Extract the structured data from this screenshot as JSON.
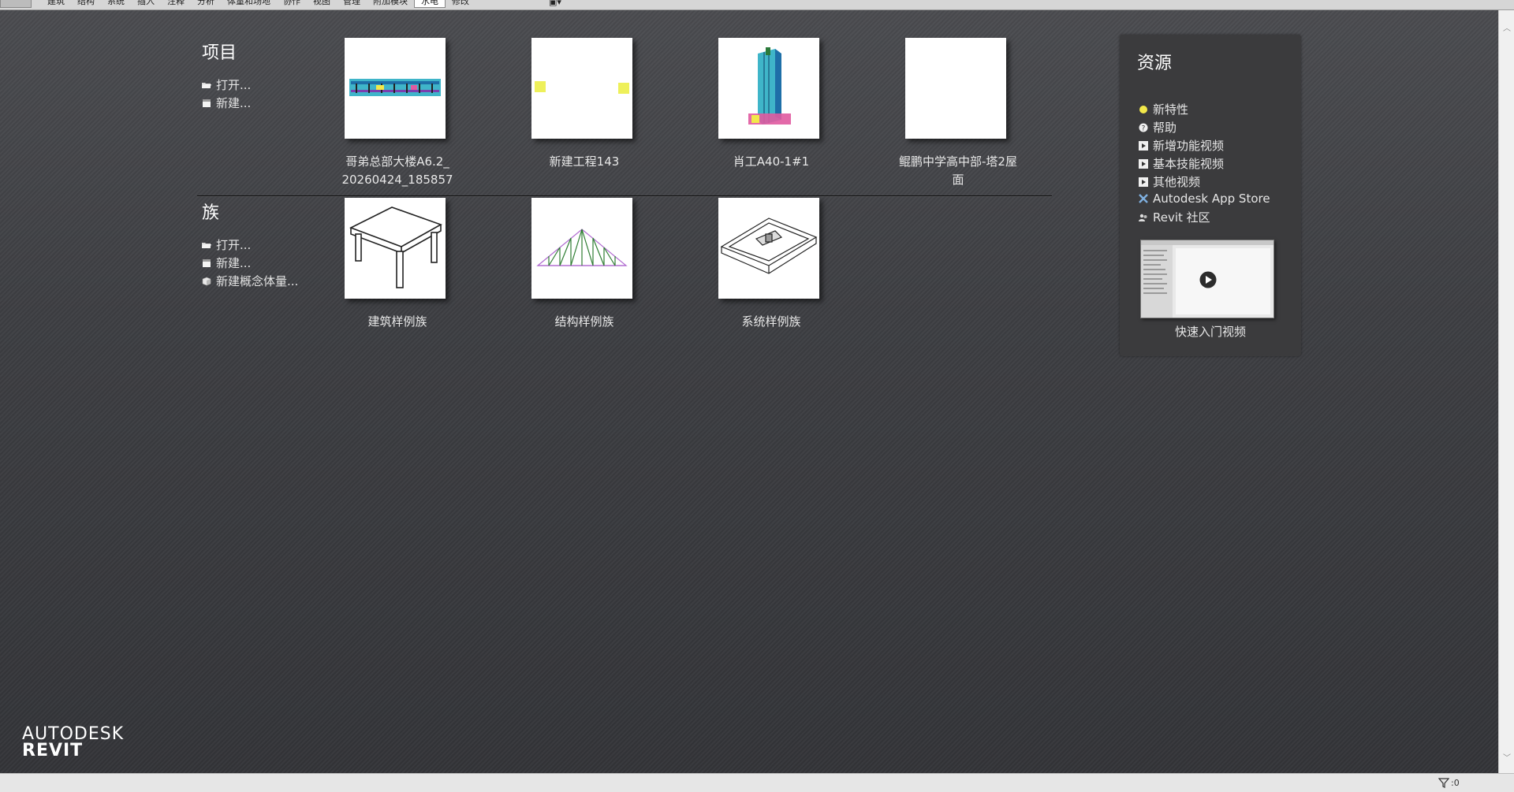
{
  "ribbon": {
    "tabs": [
      "建筑",
      "结构",
      "系统",
      "插入",
      "注释",
      "分析",
      "体量和场地",
      "协作",
      "视图",
      "管理",
      "附加模块",
      "水电",
      "修改"
    ],
    "active_tab_index": 11
  },
  "projects": {
    "title": "项目",
    "open_label": "打开...",
    "new_label": "新建...",
    "items": [
      {
        "label": "哥弟总部大楼A6.2_\n20260424_185857"
      },
      {
        "label": "新建工程143"
      },
      {
        "label": "肖工A40-1#1"
      },
      {
        "label": "鲲鹏中学高中部-塔2屋\n面"
      }
    ]
  },
  "families": {
    "title": "族",
    "open_label": "打开...",
    "new_label": "新建...",
    "new_mass_label": "新建概念体量...",
    "items": [
      {
        "label": "建筑样例族"
      },
      {
        "label": "结构样例族"
      },
      {
        "label": "系统样例族"
      }
    ]
  },
  "resources": {
    "title": "资源",
    "links": [
      {
        "label": "新特性",
        "icon": "lightbulb-icon"
      },
      {
        "label": "帮助",
        "icon": "help-icon"
      },
      {
        "label": "新增功能视频",
        "icon": "play-icon"
      },
      {
        "label": "基本技能视频",
        "icon": "play-icon"
      },
      {
        "label": "其他视频",
        "icon": "play-icon"
      },
      {
        "label": "Autodesk App Store",
        "icon": "app-store-icon"
      },
      {
        "label": "Revit 社区",
        "icon": "community-icon"
      }
    ],
    "video_label": "快速入门视频"
  },
  "brand": {
    "line1": "AUTODESK",
    "line2": "REVIT"
  },
  "status": {
    "filter_count": ":0"
  },
  "colors": {
    "accent_yellow": "#f2e84a",
    "background": "#3c3d40"
  }
}
